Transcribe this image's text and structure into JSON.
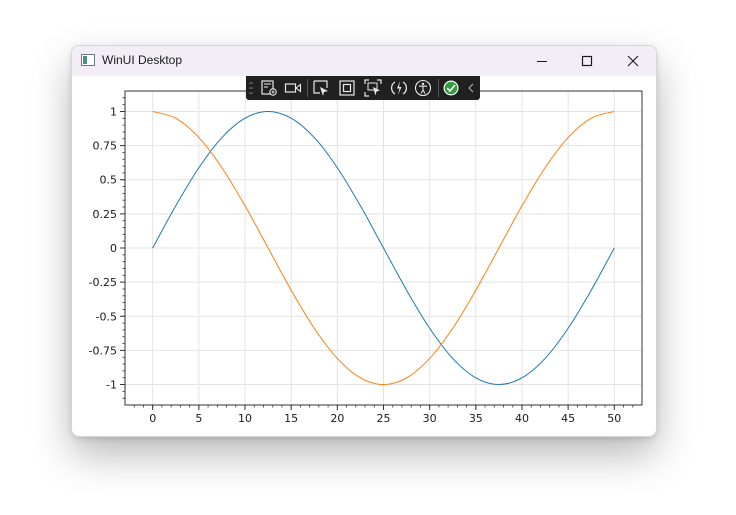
{
  "window": {
    "title": "WinUI Desktop",
    "caption_buttons": {
      "minimize": "minimize-icon",
      "maximize": "maximize-icon",
      "close": "close-icon"
    }
  },
  "debug_toolbar": {
    "icons": [
      "live-visual-tree-icon",
      "record-video-icon",
      "select-element-icon",
      "display-layout-adorners-icon",
      "track-focused-element-icon",
      "hot-reload-icon",
      "accessibility-icon",
      "binding-success-check-icon",
      "collapse-toolbar-chevron-icon"
    ],
    "check_color": "#2e9e3e"
  },
  "chart_data": {
    "type": "line",
    "title": "",
    "xlabel": "",
    "ylabel": "",
    "xlim": [
      -3,
      53
    ],
    "ylim": [
      -1.15,
      1.15
    ],
    "grid": true,
    "xticks": [
      "0",
      "5",
      "10",
      "15",
      "20",
      "25",
      "30",
      "35",
      "40",
      "45",
      "50"
    ],
    "yticks": [
      "1",
      "0.75",
      "0.5",
      "0.25",
      "0",
      "-0.25",
      "-0.5",
      "-0.75",
      "-1"
    ],
    "x": [
      0,
      2.5,
      5,
      7.5,
      10,
      12.5,
      15,
      17.5,
      20,
      22.5,
      25,
      27.5,
      30,
      32.5,
      35,
      37.5,
      40,
      42.5,
      45,
      47.5,
      50
    ],
    "series": [
      {
        "color": "#1f77b4",
        "values": [
          0,
          0.309,
          0.588,
          0.809,
          0.951,
          1,
          0.951,
          0.809,
          0.588,
          0.309,
          0,
          -0.309,
          -0.588,
          -0.809,
          -0.951,
          -1,
          -0.951,
          -0.809,
          -0.588,
          -0.309,
          0
        ]
      },
      {
        "color": "#ff7f0e",
        "values": [
          1,
          0.951,
          0.809,
          0.588,
          0.309,
          0,
          -0.309,
          -0.588,
          -0.809,
          -0.951,
          -1,
          -0.951,
          -0.809,
          -0.588,
          -0.309,
          0,
          0.309,
          0.588,
          0.809,
          0.951,
          1
        ]
      }
    ]
  }
}
